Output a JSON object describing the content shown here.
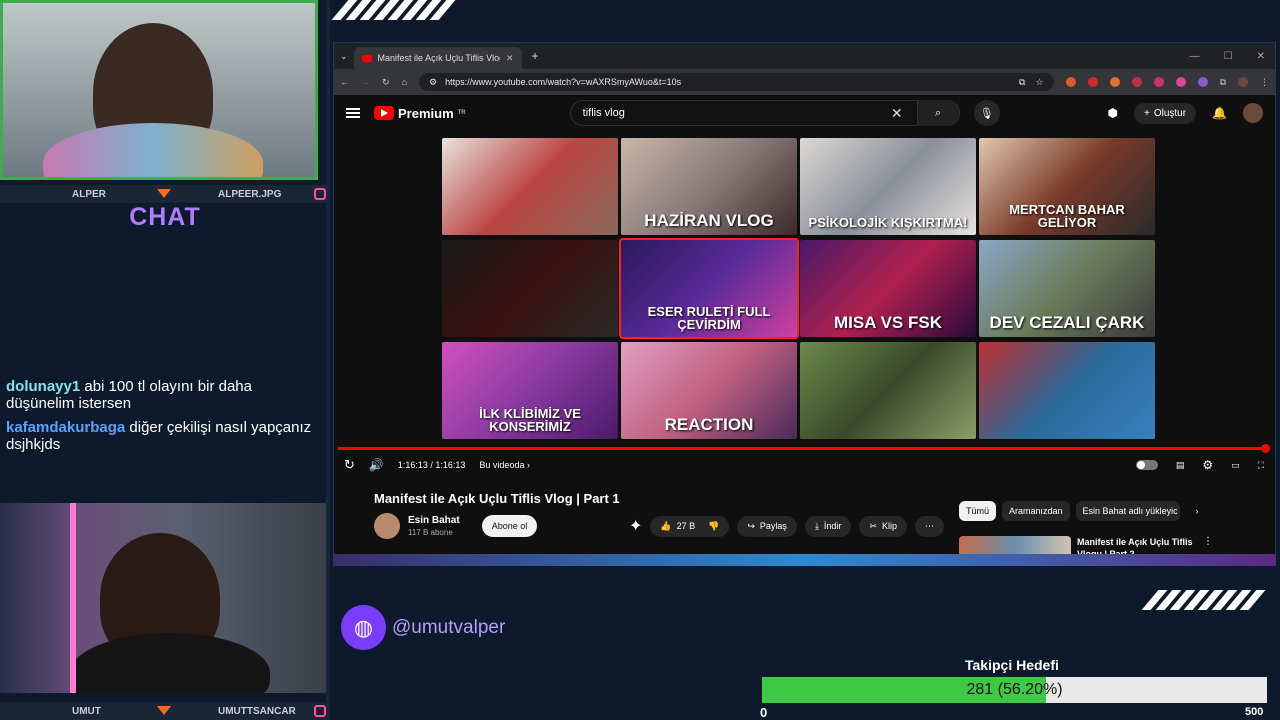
{
  "overlay": {
    "cam_top_left": "ALPER",
    "cam_top_right": "ALPEER.JPG",
    "cam_bottom_left": "UMUT",
    "cam_bottom_right": "UMUTTSANCAR",
    "chat_title": "CHAT",
    "chat": [
      {
        "user": "dolunayy1",
        "text": "abi 100 tl olayını bir daha düşünelim istersen",
        "color": "#7fe3f0"
      },
      {
        "user": "kafamdakurbaga",
        "text": "diğer çekilişi nasıl yapçanız dsjhkjds",
        "color": "#5aa2ff"
      }
    ],
    "social_handle": "@umutvalper",
    "goal": {
      "title": "Takipçi Hedefi",
      "label": "281 (56.20%)",
      "current": 281,
      "target": 500,
      "min_label": "0",
      "max_label": "500",
      "fraction": 0.562
    }
  },
  "browser": {
    "tab_title": "Manifest ile Açık Uçlu Tiflis Vlog | Part 1",
    "tab_close": "✕",
    "new_tab": "+",
    "url": "https://www.youtube.com/watch?v=wAXRSmyAWuo&t=10s"
  },
  "youtube": {
    "brand": "Premium",
    "brand_region": "TR",
    "search_value": "tiflis vlog",
    "create_label": "Oluştur",
    "thumbnails": [
      {
        "caption": "",
        "bg": "linear-gradient(135deg,#e8e3dc,#b44,#8a6a5a)"
      },
      {
        "caption": "HAZİRAN VLOG",
        "bg": "linear-gradient(135deg,#c8b8a8,#8a7a7a,#3a2a2a)"
      },
      {
        "caption": "PSİKOLOJİK KIŞKIRTMA!",
        "bg": "linear-gradient(135deg,#dcd8d2,#8a8f9a,#e8e4e0)"
      },
      {
        "caption": "MERTCAN BAHAR GELİYOR",
        "bg": "linear-gradient(135deg,#e0c8b0,#7a3a2a,#2a2a2a)"
      },
      {
        "caption": "",
        "bg": "linear-gradient(135deg,#1a1a1a,#3a1010,#2a2a2a)"
      },
      {
        "caption": "ESER RULETİ FULL ÇEVİRDİM",
        "bg": "linear-gradient(135deg,#2a1a5a,#5a2a9a,#d040a0)"
      },
      {
        "caption": "MISA VS FSK",
        "bg": "linear-gradient(135deg,#4a1a6a,#b02050,#2a0a3a)"
      },
      {
        "caption": "DEV CEZALI ÇARK",
        "bg": "linear-gradient(135deg,#8aa8c8,#6a7a5a,#3a3a3a)"
      },
      {
        "caption": "İLK KLİBİMİZ VE KONSERİMİZ",
        "bg": "linear-gradient(135deg,#d050c0,#8a3aa0,#4a1a6a)"
      },
      {
        "caption": "REACTION",
        "bg": "linear-gradient(135deg,#e0a0c0,#c06080,#4a2a5a)"
      },
      {
        "caption": "",
        "bg": "linear-gradient(135deg,#6a8a4a,#3a4a2a,#8aa06a)"
      },
      {
        "caption": "",
        "bg": "linear-gradient(135deg,#c03030,#2a6a9a,#3a80c0)"
      }
    ],
    "time": "1:16:13 / 1:16:13",
    "chapter": "Bu videoda",
    "video_title": "Manifest ile Açık Uçlu Tiflis Vlog | Part 1",
    "channel": "Esin Bahat",
    "subscribers": "117 B abone",
    "subscribe_label": "Abone ol",
    "likes": "27 B",
    "share": "Paylaş",
    "download": "İndir",
    "clip": "Klip",
    "chips": [
      "Tümü",
      "Aramanızdan",
      "Esin Bahat adlı yükleyic"
    ],
    "rec_title": "Manifest ile Açık Uçlu Tiflis Vlogu | Part 2"
  },
  "colors": {
    "accent_purple": "#b07cff",
    "goal_green": "#3ec945",
    "yt_red": "#ff0000"
  }
}
